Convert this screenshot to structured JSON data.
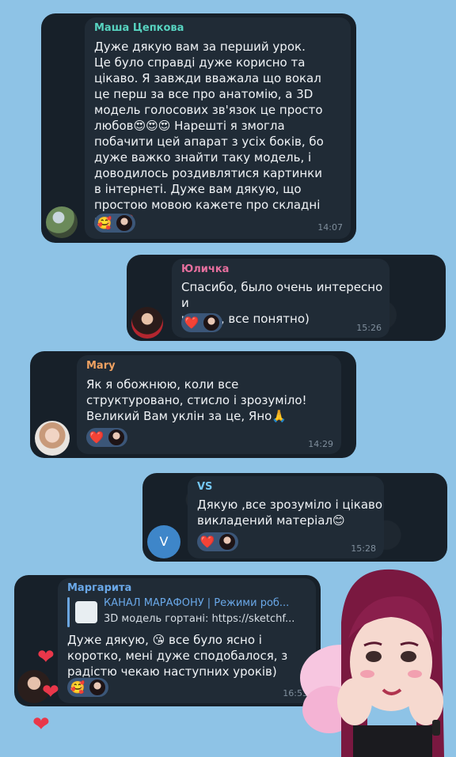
{
  "messages": [
    {
      "author": "Маша Цепкова",
      "text": "Дуже дякую вам за перший урок.\nЦе було справді дуже корисно та\nцікаво. Я завжди вважала що вокал\nце перш за все про анатомію, а 3D\nмодель голосових зв'язок це просто\nлюбов😍😍😍 Нарешті я змогла\nпобачити цей апарат з усіх боків, бо\nдуже важко знайти таку модель, і\nдоводилось роздивлятися картинки\nв інтернеті. Дуже вам дякую, що\nпростою мовою кажете про складні\nречі❤️",
      "reaction": "🥰",
      "time": "14:07",
      "name_color": "#57d3c0"
    },
    {
      "author": "Юличка",
      "text": "Спасибо, было очень интересно и\nчетко , все понятно)",
      "reaction": "❤️",
      "time": "15:26",
      "name_color": "#e66f9e"
    },
    {
      "author": "Mary",
      "text": "Як я обожнюю, коли все\nструктуровано, стисло і зрозуміло!\nВеликий Вам уклін за це, Яно🙏",
      "reaction": "❤️",
      "time": "14:29",
      "name_color": "#f0a262"
    },
    {
      "author": "VS",
      "avatar_letter": "V",
      "text": "Дякую ,все зрозуміло і цікаво\nвикладений матеріал😊",
      "reaction": "❤️",
      "time": "15:28",
      "name_color": "#74c7f5"
    },
    {
      "author": "Маргарита",
      "link_title": "КАНАЛ МАРАФОНУ | Режими роб...",
      "link_text": "3D модель гортані: https://sketchf...",
      "text": "Дуже дякую, 😘 все було ясно і\nкоротко, мені дуже сподобалося, з\nрадістю чекаю наступних уроків)",
      "reaction": "🥰",
      "time": "16:53",
      "name_color": "#6aa8e8"
    }
  ],
  "decor": {
    "heart_symbol": "❤"
  }
}
